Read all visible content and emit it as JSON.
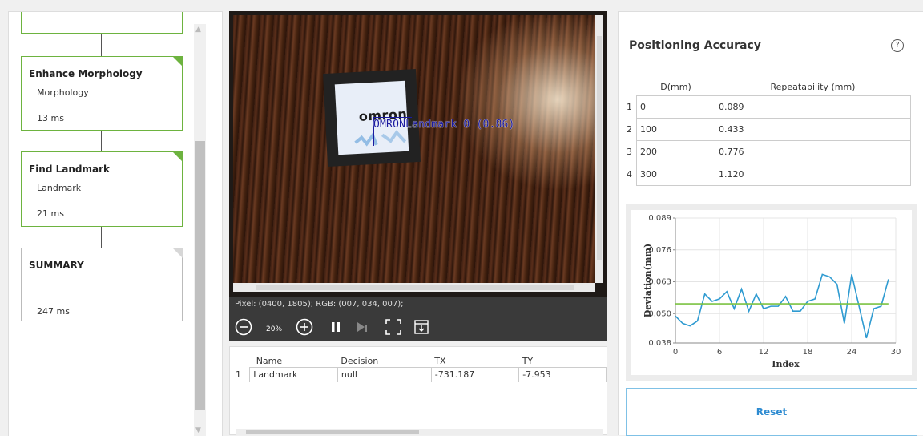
{
  "flow": {
    "steps": [
      {
        "title": "",
        "sub": "",
        "ms": ""
      },
      {
        "title": "Enhance Morphology",
        "sub": "Morphology",
        "ms": "13 ms"
      },
      {
        "title": "Find Landmark",
        "sub": "Landmark",
        "ms": "21 ms"
      },
      {
        "title": "SUMMARY",
        "sub": "",
        "ms": "247 ms"
      }
    ]
  },
  "viewer": {
    "marker_logo": "omron",
    "detection_label": "OMRONLandmark 0 (0.86)",
    "pixel_info": "Pixel: (0400, 1805); RGB: (007, 034, 007);",
    "zoom": "20%"
  },
  "results_table": {
    "headers": [
      "Name",
      "Decision",
      "TX",
      "TY"
    ],
    "rows": [
      {
        "index": "1",
        "name": "Landmark",
        "decision": "null",
        "tx": "-731.187",
        "ty": "-7.953"
      }
    ]
  },
  "accuracy": {
    "title": "Positioning Accuracy",
    "help_icon": "?",
    "headers": [
      "D(mm)",
      "Repeatability (mm)"
    ],
    "rows": [
      {
        "index": "1",
        "d": "0",
        "rep": "0.089"
      },
      {
        "index": "2",
        "d": "100",
        "rep": "0.433"
      },
      {
        "index": "3",
        "d": "200",
        "rep": "0.776"
      },
      {
        "index": "4",
        "d": "300",
        "rep": "1.120"
      }
    ],
    "reset_label": "Reset"
  },
  "chart_data": {
    "type": "line",
    "title": "",
    "xlabel": "Index",
    "ylabel": "Deviation(mm)",
    "xlim": [
      0,
      30
    ],
    "ylim": [
      0.038,
      0.089
    ],
    "xticks": [
      "0",
      "6",
      "12",
      "18",
      "24",
      "30"
    ],
    "yticks": [
      "0.038",
      "0.050",
      "0.063",
      "0.076",
      "0.089"
    ],
    "grid": true,
    "series": [
      {
        "color": "#2f9bd1",
        "x": [
          0,
          1,
          2,
          3,
          4,
          5,
          6,
          7,
          8,
          9,
          10,
          11,
          12,
          13,
          14,
          15,
          16,
          17,
          18,
          19,
          20,
          21,
          22,
          23,
          24,
          25,
          26,
          27,
          28,
          29
        ],
        "y": [
          0.049,
          0.046,
          0.045,
          0.047,
          0.058,
          0.055,
          0.056,
          0.059,
          0.052,
          0.06,
          0.051,
          0.058,
          0.052,
          0.053,
          0.053,
          0.057,
          0.051,
          0.051,
          0.055,
          0.056,
          0.066,
          0.065,
          0.062,
          0.046,
          0.066,
          0.053,
          0.04,
          0.052,
          0.053,
          0.064
        ]
      },
      {
        "color": "#7cc242",
        "x": [
          0,
          29
        ],
        "y": [
          0.054,
          0.054
        ]
      }
    ]
  }
}
